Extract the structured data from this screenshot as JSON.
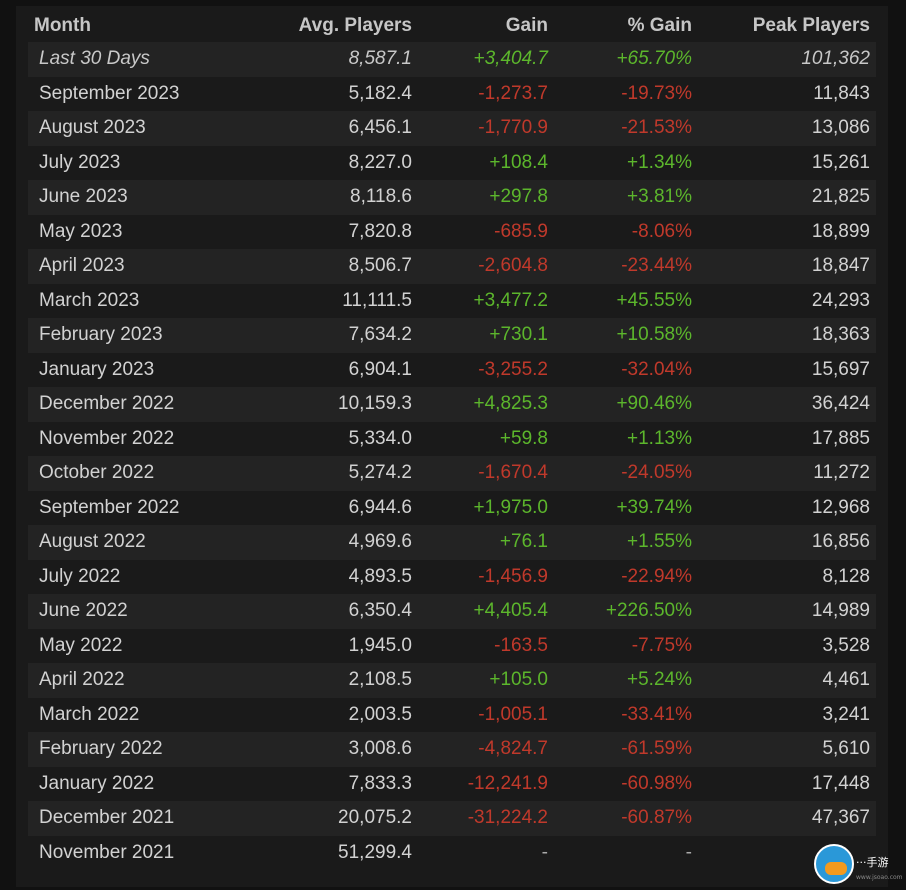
{
  "table": {
    "headers": [
      "Month",
      "Avg. Players",
      "Gain",
      "% Gain",
      "Peak Players"
    ],
    "rows": [
      {
        "month": "Last 30 Days",
        "avg": "8,587.1",
        "gain": "+3,404.7",
        "pct": "+65.70%",
        "peak": "101,362",
        "trend": "pos",
        "italic": true
      },
      {
        "month": "September 2023",
        "avg": "5,182.4",
        "gain": "-1,273.7",
        "pct": "-19.73%",
        "peak": "11,843",
        "trend": "neg"
      },
      {
        "month": "August 2023",
        "avg": "6,456.1",
        "gain": "-1,770.9",
        "pct": "-21.53%",
        "peak": "13,086",
        "trend": "neg"
      },
      {
        "month": "July 2023",
        "avg": "8,227.0",
        "gain": "+108.4",
        "pct": "+1.34%",
        "peak": "15,261",
        "trend": "pos"
      },
      {
        "month": "June 2023",
        "avg": "8,118.6",
        "gain": "+297.8",
        "pct": "+3.81%",
        "peak": "21,825",
        "trend": "pos"
      },
      {
        "month": "May 2023",
        "avg": "7,820.8",
        "gain": "-685.9",
        "pct": "-8.06%",
        "peak": "18,899",
        "trend": "neg"
      },
      {
        "month": "April 2023",
        "avg": "8,506.7",
        "gain": "-2,604.8",
        "pct": "-23.44%",
        "peak": "18,847",
        "trend": "neg"
      },
      {
        "month": "March 2023",
        "avg": "11,111.5",
        "gain": "+3,477.2",
        "pct": "+45.55%",
        "peak": "24,293",
        "trend": "pos"
      },
      {
        "month": "February 2023",
        "avg": "7,634.2",
        "gain": "+730.1",
        "pct": "+10.58%",
        "peak": "18,363",
        "trend": "pos"
      },
      {
        "month": "January 2023",
        "avg": "6,904.1",
        "gain": "-3,255.2",
        "pct": "-32.04%",
        "peak": "15,697",
        "trend": "neg"
      },
      {
        "month": "December 2022",
        "avg": "10,159.3",
        "gain": "+4,825.3",
        "pct": "+90.46%",
        "peak": "36,424",
        "trend": "pos"
      },
      {
        "month": "November 2022",
        "avg": "5,334.0",
        "gain": "+59.8",
        "pct": "+1.13%",
        "peak": "17,885",
        "trend": "pos"
      },
      {
        "month": "October 2022",
        "avg": "5,274.2",
        "gain": "-1,670.4",
        "pct": "-24.05%",
        "peak": "11,272",
        "trend": "neg"
      },
      {
        "month": "September 2022",
        "avg": "6,944.6",
        "gain": "+1,975.0",
        "pct": "+39.74%",
        "peak": "12,968",
        "trend": "pos"
      },
      {
        "month": "August 2022",
        "avg": "4,969.6",
        "gain": "+76.1",
        "pct": "+1.55%",
        "peak": "16,856",
        "trend": "pos"
      },
      {
        "month": "July 2022",
        "avg": "4,893.5",
        "gain": "-1,456.9",
        "pct": "-22.94%",
        "peak": "8,128",
        "trend": "neg"
      },
      {
        "month": "June 2022",
        "avg": "6,350.4",
        "gain": "+4,405.4",
        "pct": "+226.50%",
        "peak": "14,989",
        "trend": "pos"
      },
      {
        "month": "May 2022",
        "avg": "1,945.0",
        "gain": "-163.5",
        "pct": "-7.75%",
        "peak": "3,528",
        "trend": "neg"
      },
      {
        "month": "April 2022",
        "avg": "2,108.5",
        "gain": "+105.0",
        "pct": "+5.24%",
        "peak": "4,461",
        "trend": "pos"
      },
      {
        "month": "March 2022",
        "avg": "2,003.5",
        "gain": "-1,005.1",
        "pct": "-33.41%",
        "peak": "3,241",
        "trend": "neg"
      },
      {
        "month": "February 2022",
        "avg": "3,008.6",
        "gain": "-4,824.7",
        "pct": "-61.59%",
        "peak": "5,610",
        "trend": "neg"
      },
      {
        "month": "January 2022",
        "avg": "7,833.3",
        "gain": "-12,241.9",
        "pct": "-60.98%",
        "peak": "17,448",
        "trend": "neg"
      },
      {
        "month": "December 2021",
        "avg": "20,075.2",
        "gain": "-31,224.2",
        "pct": "-60.87%",
        "peak": "47,367",
        "trend": "neg"
      },
      {
        "month": "November 2021",
        "avg": "51,299.4",
        "gain": "-",
        "pct": "-",
        "peak": "",
        "trend": "na"
      }
    ]
  },
  "colors": {
    "positive": "#5cb62c",
    "negative": "#c0392b",
    "background": "#1a1a1a",
    "row_alt": "#232323"
  },
  "watermark": {
    "icon": "gamepad-logo-icon",
    "text": "···手游",
    "sub": "www.jsoao.com"
  }
}
